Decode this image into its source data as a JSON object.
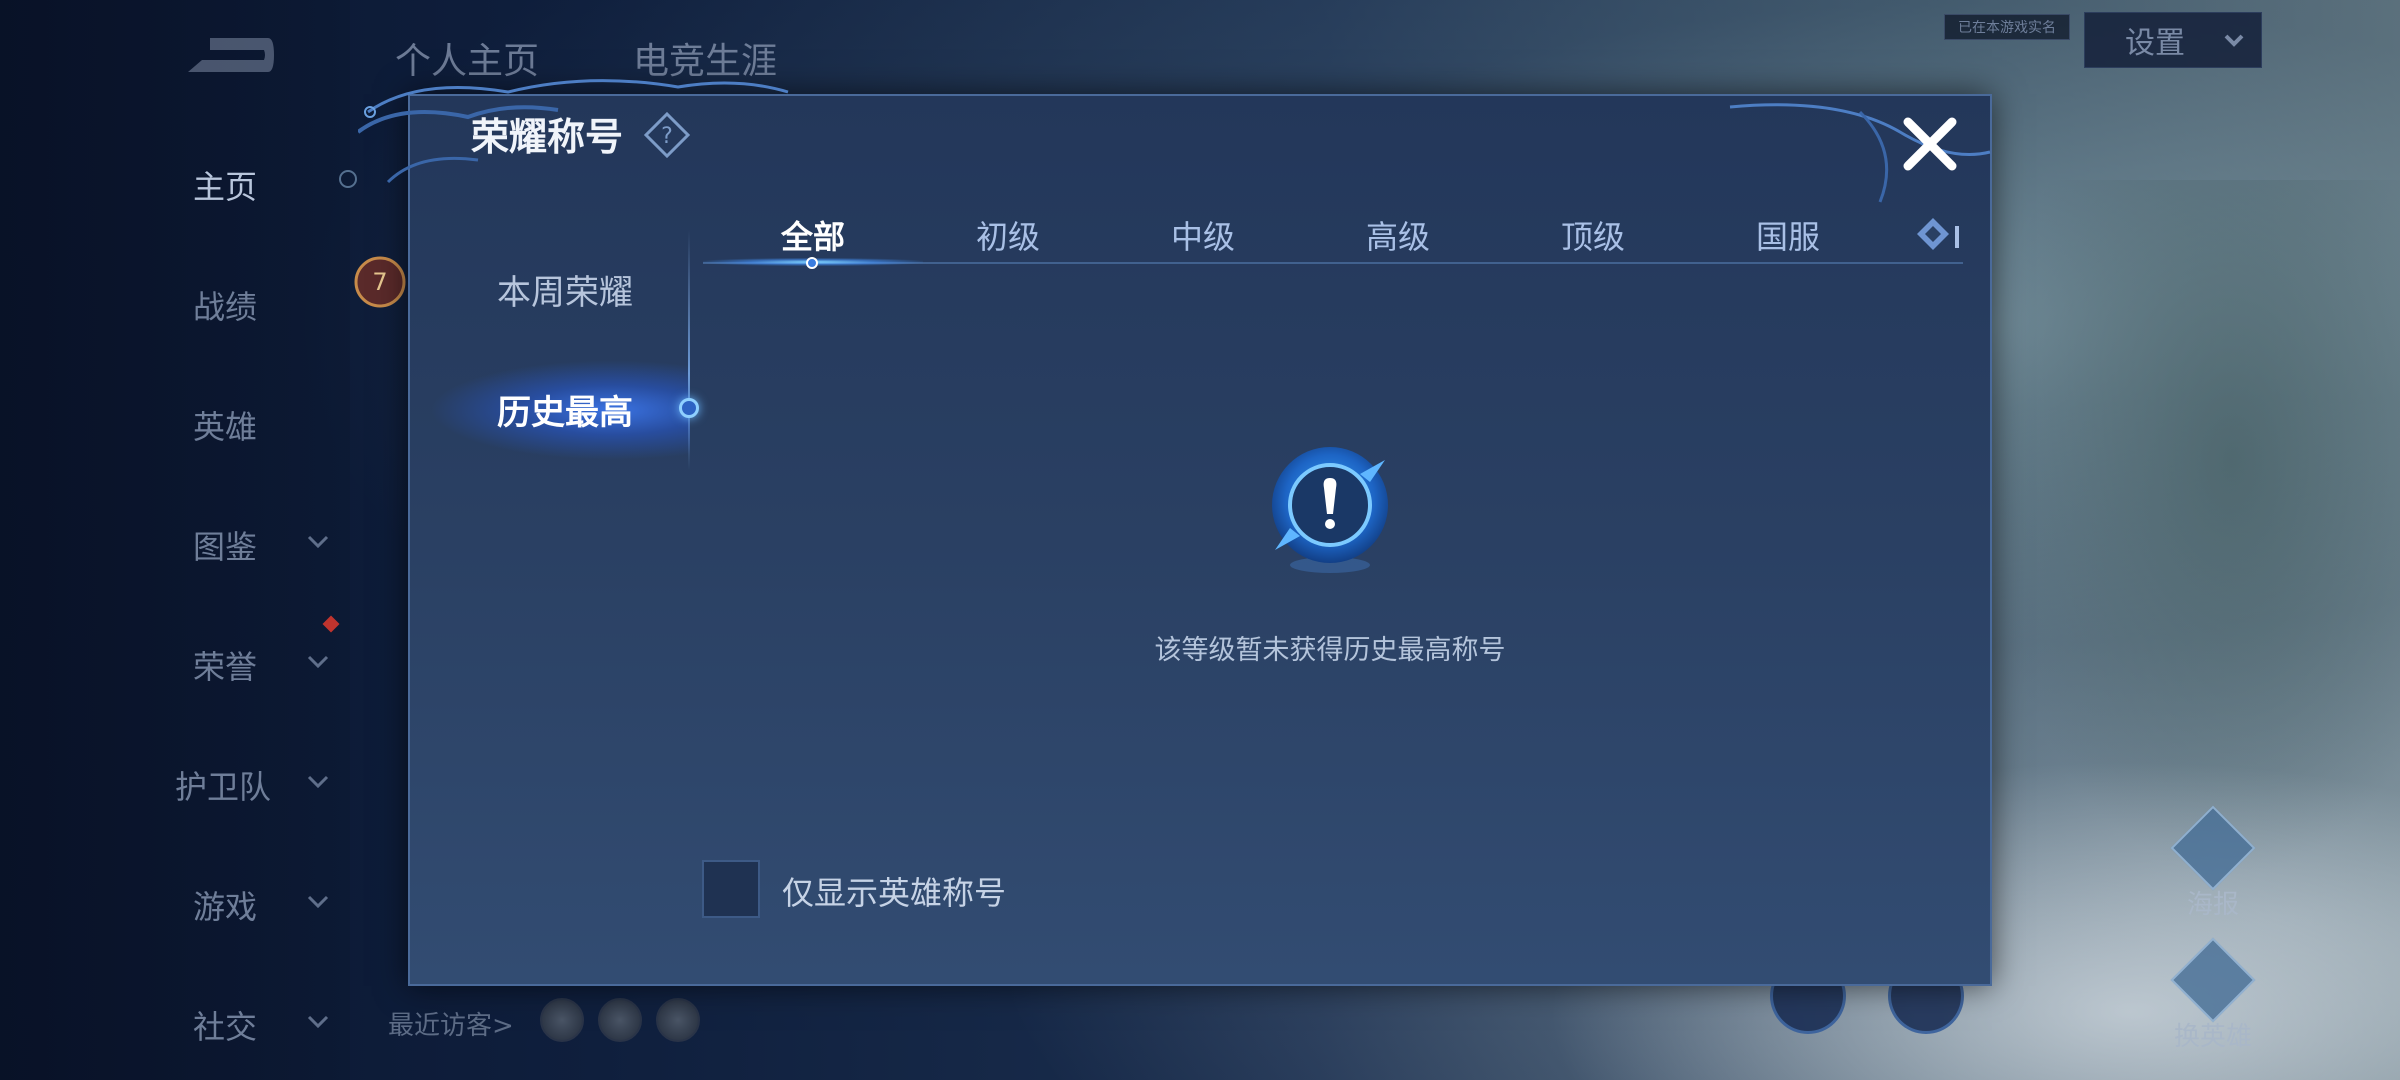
{
  "top_nav": {
    "tabs": [
      "个人主页",
      "电竞生涯"
    ]
  },
  "top_right": {
    "realname_tag": "已在本游戏实名",
    "settings_label": "设置"
  },
  "left_nav": {
    "items": [
      {
        "label": "主页",
        "has_arrow": false
      },
      {
        "label": "战绩",
        "has_arrow": false
      },
      {
        "label": "英雄",
        "has_arrow": false
      },
      {
        "label": "图鉴",
        "has_arrow": true
      },
      {
        "label": "荣誉",
        "has_arrow": true
      },
      {
        "label": "护卫队",
        "has_arrow": true
      },
      {
        "label": "游戏",
        "has_arrow": true
      },
      {
        "label": "社交",
        "has_arrow": true
      }
    ]
  },
  "background_level_badge": "7",
  "visitors": {
    "label": "最近访客>"
  },
  "side_actions": {
    "poster": "海报",
    "change_hero": "换英雄"
  },
  "modal": {
    "title": "荣耀称号",
    "sub_tabs": [
      "本周荣耀",
      "历史最高"
    ],
    "active_sub_tab": "历史最高",
    "rank_tabs": [
      "全部",
      "初级",
      "中级",
      "高级",
      "顶级",
      "国服"
    ],
    "active_rank_tab": "全部",
    "empty_message": "该等级暂未获得历史最高称号",
    "checkbox_label": "仅显示英雄称号",
    "checkbox_checked": false
  },
  "colors": {
    "accent": "#3a7de0",
    "modal_bg": "#2a4063",
    "text_primary": "#ffffff",
    "text_secondary": "#b4c4db"
  }
}
